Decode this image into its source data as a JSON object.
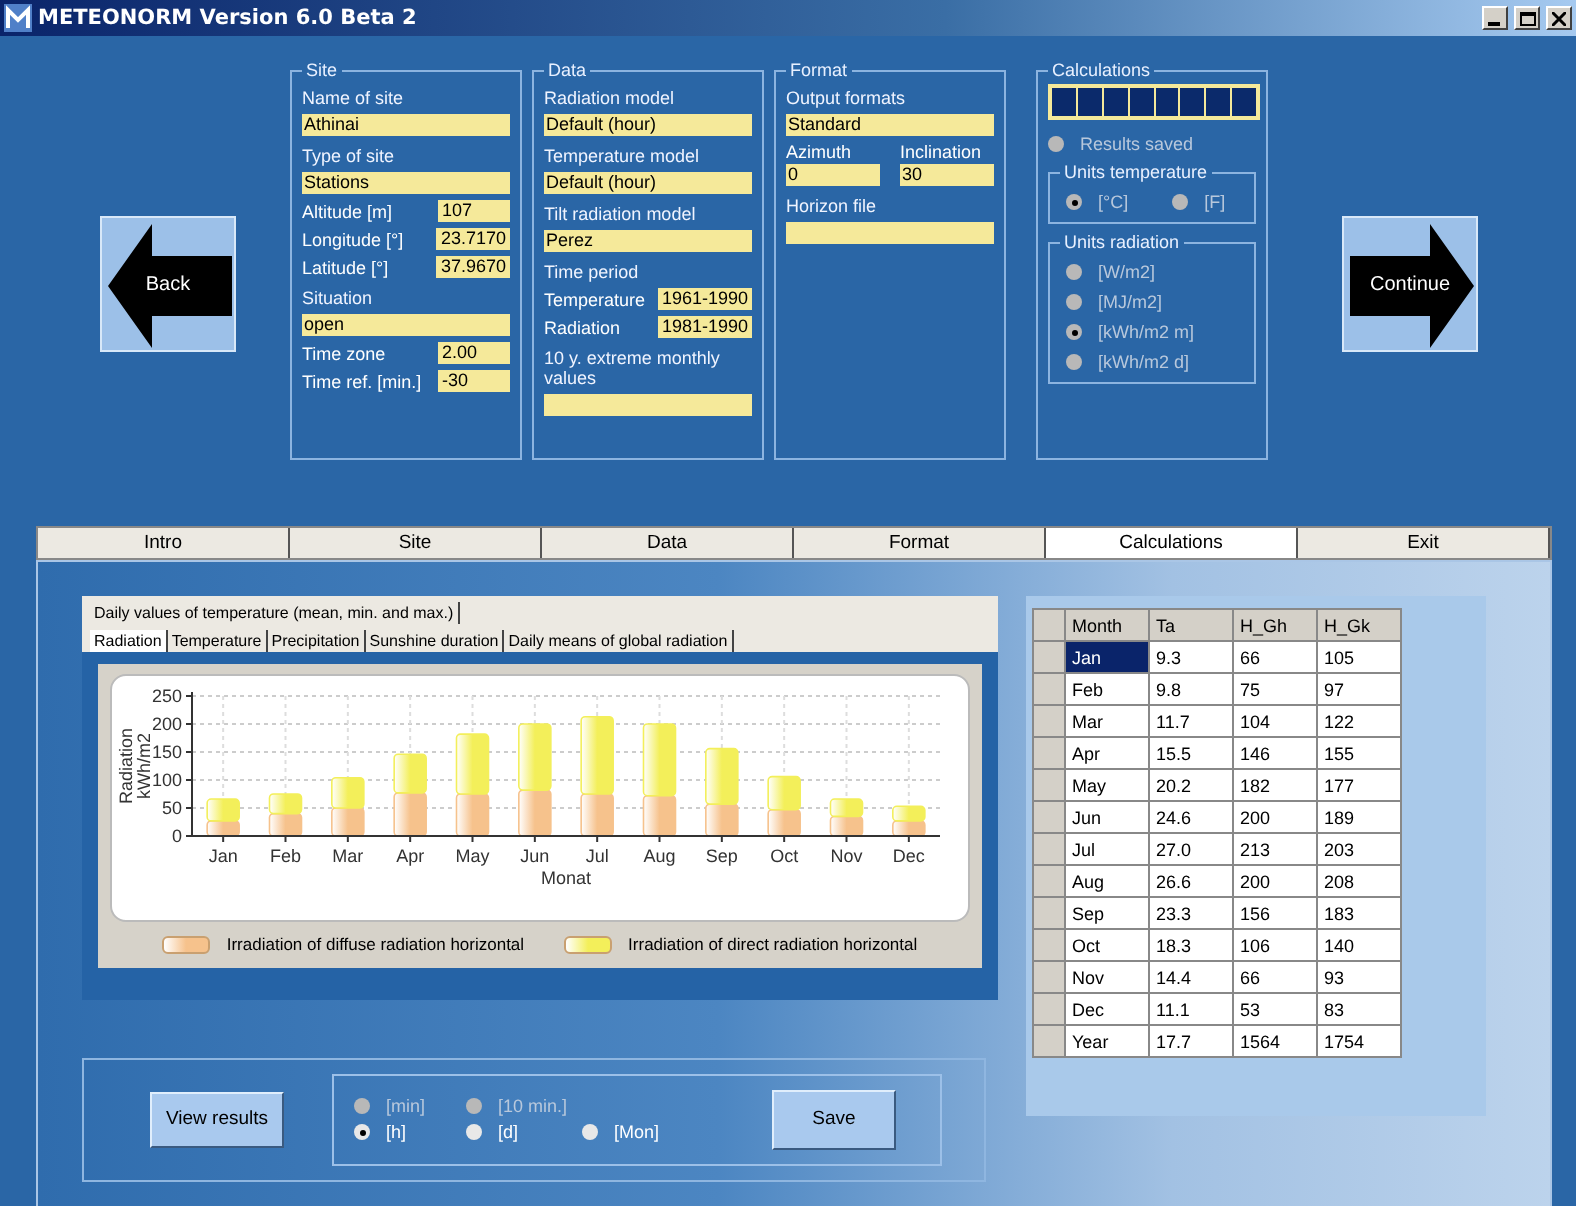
{
  "window": {
    "title": "METEONORM Version 6.0 Beta 2"
  },
  "back_button": "Back",
  "continue_button": "Continue",
  "panels": [
    {
      "title": "Site",
      "items": [
        {
          "kind": "label",
          "label": "Name of site"
        },
        {
          "kind": "field",
          "value": "Athinai"
        },
        {
          "kind": "label",
          "label": "Type of site"
        },
        {
          "kind": "field",
          "value": "Stations"
        },
        {
          "kind": "pair",
          "label": "Altitude [m]",
          "value": "107"
        },
        {
          "kind": "pair",
          "label": "Longitude [°]",
          "value": "23.7170"
        },
        {
          "kind": "pair",
          "label": "Latitude [°]",
          "value": "37.9670"
        },
        {
          "kind": "label",
          "label": "Situation"
        },
        {
          "kind": "field",
          "value": "open"
        },
        {
          "kind": "pair",
          "label": "Time zone",
          "value": "2.00"
        },
        {
          "kind": "pair",
          "label": "Time ref. [min.]",
          "value": "-30"
        }
      ]
    },
    {
      "title": "Data",
      "items": [
        {
          "kind": "label",
          "label": "Radiation model"
        },
        {
          "kind": "field",
          "value": "Default (hour)"
        },
        {
          "kind": "label",
          "label": "Temperature model"
        },
        {
          "kind": "field",
          "value": "Default (hour)"
        },
        {
          "kind": "label",
          "label": "Tilt radiation model"
        },
        {
          "kind": "field",
          "value": "Perez"
        },
        {
          "kind": "label",
          "label": "Time period"
        },
        {
          "kind": "pair",
          "label": "Temperature",
          "value": "1961-1990"
        },
        {
          "kind": "pair",
          "label": "Radiation",
          "value": "1981-1990"
        },
        {
          "kind": "label",
          "label": "10 y. extreme monthly values"
        },
        {
          "kind": "field"
        }
      ]
    },
    {
      "title": "Format",
      "items": [
        {
          "kind": "label",
          "label": "Output formats"
        },
        {
          "kind": "field",
          "value": "Standard"
        },
        {
          "kind": "duo",
          "fields": [
            {
              "label": "Azimuth",
              "value": "0"
            },
            {
              "label": "Inclination",
              "value": "30"
            }
          ]
        },
        {
          "kind": "label",
          "label": "Horizon file"
        },
        {
          "kind": "field"
        }
      ]
    }
  ],
  "calculations": {
    "title": "Calculations",
    "results_saved": {
      "label": "Results saved",
      "selected": false,
      "disabled": true
    },
    "groups": [
      {
        "title": "Units temperature",
        "kind": "row",
        "options": [
          {
            "label": "[°C]",
            "selected": true,
            "disabled": true
          },
          {
            "label": "[F]",
            "selected": false,
            "disabled": true
          }
        ]
      },
      {
        "title": "Units radiation",
        "kind": "column",
        "options": [
          {
            "label": "[W/m2]",
            "selected": false,
            "disabled": true
          },
          {
            "label": "[MJ/m2]",
            "selected": false,
            "disabled": true
          },
          {
            "label": "[kWh/m2 m]",
            "selected": true,
            "disabled": true
          },
          {
            "label": "[kWh/m2 d]",
            "selected": false,
            "disabled": true
          }
        ]
      }
    ]
  },
  "tabs": [
    {
      "label": "Intro",
      "selected": false
    },
    {
      "label": "Site",
      "selected": false
    },
    {
      "label": "Data",
      "selected": false
    },
    {
      "label": "Format",
      "selected": false
    },
    {
      "label": "Calculations",
      "selected": true
    },
    {
      "label": "Exit",
      "selected": false
    }
  ],
  "sub_tabs": [
    [
      {
        "label": "Daily values of temperature (mean, min. and max.)",
        "selected": false
      }
    ],
    [
      {
        "label": "Radiation",
        "selected": true
      },
      {
        "label": "Temperature",
        "selected": false
      },
      {
        "label": "Precipitation",
        "selected": false
      },
      {
        "label": "Sunshine duration",
        "selected": false
      },
      {
        "label": "Daily means of global radiation",
        "selected": false
      }
    ]
  ],
  "chart_data": {
    "type": "bar",
    "stacked": true,
    "grid": true,
    "xlabel": "Monat",
    "ylabel": "Radiation kWh/m2",
    "categories": [
      "Jan",
      "Feb",
      "Mar",
      "Apr",
      "May",
      "Jun",
      "Jul",
      "Aug",
      "Sep",
      "Oct",
      "Nov",
      "Dec"
    ],
    "ylim": [
      0,
      250
    ],
    "yticks": [
      0,
      50,
      100,
      150,
      200,
      250
    ],
    "series": [
      {
        "name": "Irradiation of diffuse radiation horizontal",
        "color": "#f6c28c",
        "values": [
          27,
          40,
          50,
          77,
          75,
          82,
          75,
          72,
          57,
          47,
          35,
          27
        ]
      },
      {
        "name": "Irradiation of direct radiation horizontal",
        "color": "#f3ef5a",
        "values": [
          39,
          35,
          54,
          69,
          107,
          118,
          138,
          128,
          99,
          59,
          31,
          26
        ]
      }
    ]
  },
  "table": {
    "columns": [
      "Month",
      "Ta",
      "H_Gh",
      "H_Gk"
    ],
    "rows": [
      {
        "cells": [
          "Jan",
          "9.3",
          "66",
          "105"
        ],
        "selected": true
      },
      {
        "cells": [
          "Feb",
          "9.8",
          "75",
          "97"
        ],
        "selected": false
      },
      {
        "cells": [
          "Mar",
          "11.7",
          "104",
          "122"
        ],
        "selected": false
      },
      {
        "cells": [
          "Apr",
          "15.5",
          "146",
          "155"
        ],
        "selected": false
      },
      {
        "cells": [
          "May",
          "20.2",
          "182",
          "177"
        ],
        "selected": false
      },
      {
        "cells": [
          "Jun",
          "24.6",
          "200",
          "189"
        ],
        "selected": false
      },
      {
        "cells": [
          "Jul",
          "27.0",
          "213",
          "203"
        ],
        "selected": false
      },
      {
        "cells": [
          "Aug",
          "26.6",
          "200",
          "208"
        ],
        "selected": false
      },
      {
        "cells": [
          "Sep",
          "23.3",
          "156",
          "183"
        ],
        "selected": false
      },
      {
        "cells": [
          "Oct",
          "18.3",
          "106",
          "140"
        ],
        "selected": false
      },
      {
        "cells": [
          "Nov",
          "14.4",
          "66",
          "93"
        ],
        "selected": false
      },
      {
        "cells": [
          "Dec",
          "11.1",
          "53",
          "83"
        ],
        "selected": false
      },
      {
        "cells": [
          "Year",
          "17.7",
          "1564",
          "1754"
        ],
        "selected": false
      }
    ]
  },
  "view_results_button": "View results",
  "resolution_options": [
    [
      {
        "label": "[min]",
        "selected": false,
        "disabled": true
      },
      {
        "label": "[10 min.]",
        "selected": false,
        "disabled": true
      }
    ],
    [
      {
        "label": "[h]",
        "selected": true,
        "disabled": false
      },
      {
        "label": "[d]",
        "selected": false,
        "disabled": false
      },
      {
        "label": "[Mon]",
        "selected": false,
        "disabled": false
      }
    ]
  ],
  "save_button": "Save"
}
